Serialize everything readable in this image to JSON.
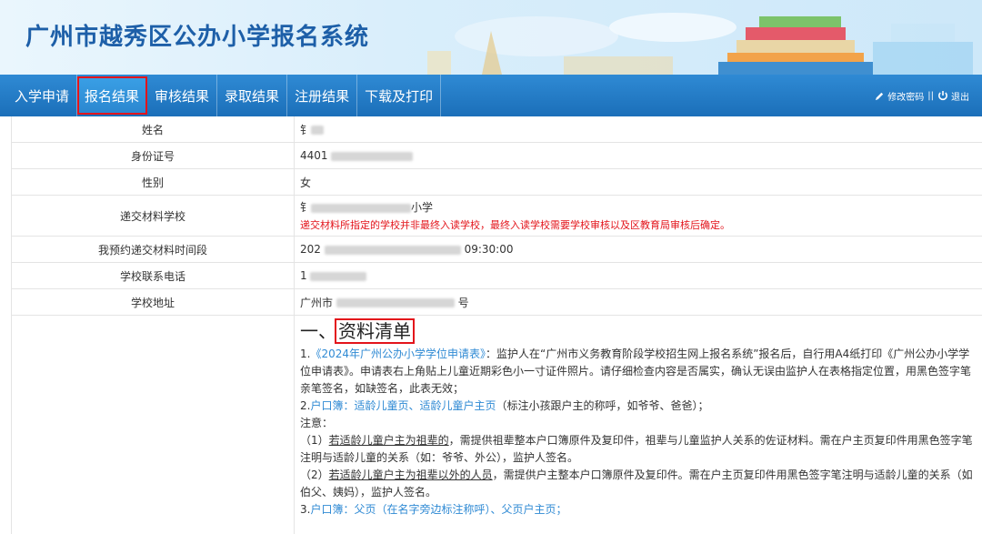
{
  "header": {
    "title": "广州市越秀区公办小学报名系统"
  },
  "nav": {
    "items": [
      {
        "label": "入学申请",
        "active": false
      },
      {
        "label": "报名结果",
        "active": true
      },
      {
        "label": "审核结果",
        "active": false
      },
      {
        "label": "录取结果",
        "active": false
      },
      {
        "label": "注册结果",
        "active": false
      },
      {
        "label": "下载及打印",
        "active": false
      }
    ],
    "change_password": "修改密码",
    "separator": "||",
    "logout": "退出"
  },
  "info": {
    "name_label": "姓名",
    "name_value": "钅",
    "id_label": "身份证号",
    "id_value": "4401",
    "gender_label": "性别",
    "gender_value": "女",
    "school_label": "递交材料学校",
    "school_value_prefix": "钅",
    "school_value_suffix": "小学",
    "school_warning": "递交材料所指定的学校并非最终入读学校，最终入读学校需要学校审核以及区教育局审核后确定。",
    "time_label": "我预约递交材料时间段",
    "time_value_prefix": "202",
    "time_value_suffix": "09:30:00",
    "phone_label": "学校联系电话",
    "phone_value": "1",
    "address_label": "学校地址",
    "address_value_prefix": "广州市",
    "address_value_suffix": "号"
  },
  "doc": {
    "heading_prefix": "一、",
    "heading": "资料清单",
    "p1_num": "1.",
    "p1_link": "《2024年广州公办小学学位申请表》",
    "p1_text": "：监护人在“广州市义务教育阶段学校招生网上报名系统”报名后，自行用A4纸打印《广州公办小学学位申请表》。申请表右上角贴上儿童近期彩色小一寸证件照片。请仔细检查内容是否属实，确认无误由监护人在表格指定位置，用黑色签字笔亲笔签名，如缺签名，此表无效；",
    "p2_num": "2.",
    "p2_link": "户口簿：适龄儿童页、适龄儿童户主页",
    "p2_text": "（标注小孩跟户主的称呼，如爷爷、爸爸）；",
    "note": "注意：",
    "n1_num": "（1）",
    "n1_u": "若适龄儿童户主为祖辈的",
    "n1_text": "，需提供祖辈整本户口簿原件及复印件，祖辈与儿童监护人关系的佐证材料。需在户主页复印件用黑色签字笔注明与适龄儿童的关系（如：爷爷、外公），监护人签名。",
    "n2_num": "（2）",
    "n2_u": "若适龄儿童户主为祖辈以外的人员",
    "n2_text": "，需提供户主整本户口簿原件及复印件。需在户主页复印件用黑色签字笔注明与适龄儿童的关系（如伯父、姨妈），监护人签名。",
    "p3_num": "3.",
    "p3_link": "户口簿：父页（在名字旁边标注称呼）、父页户主页；"
  }
}
